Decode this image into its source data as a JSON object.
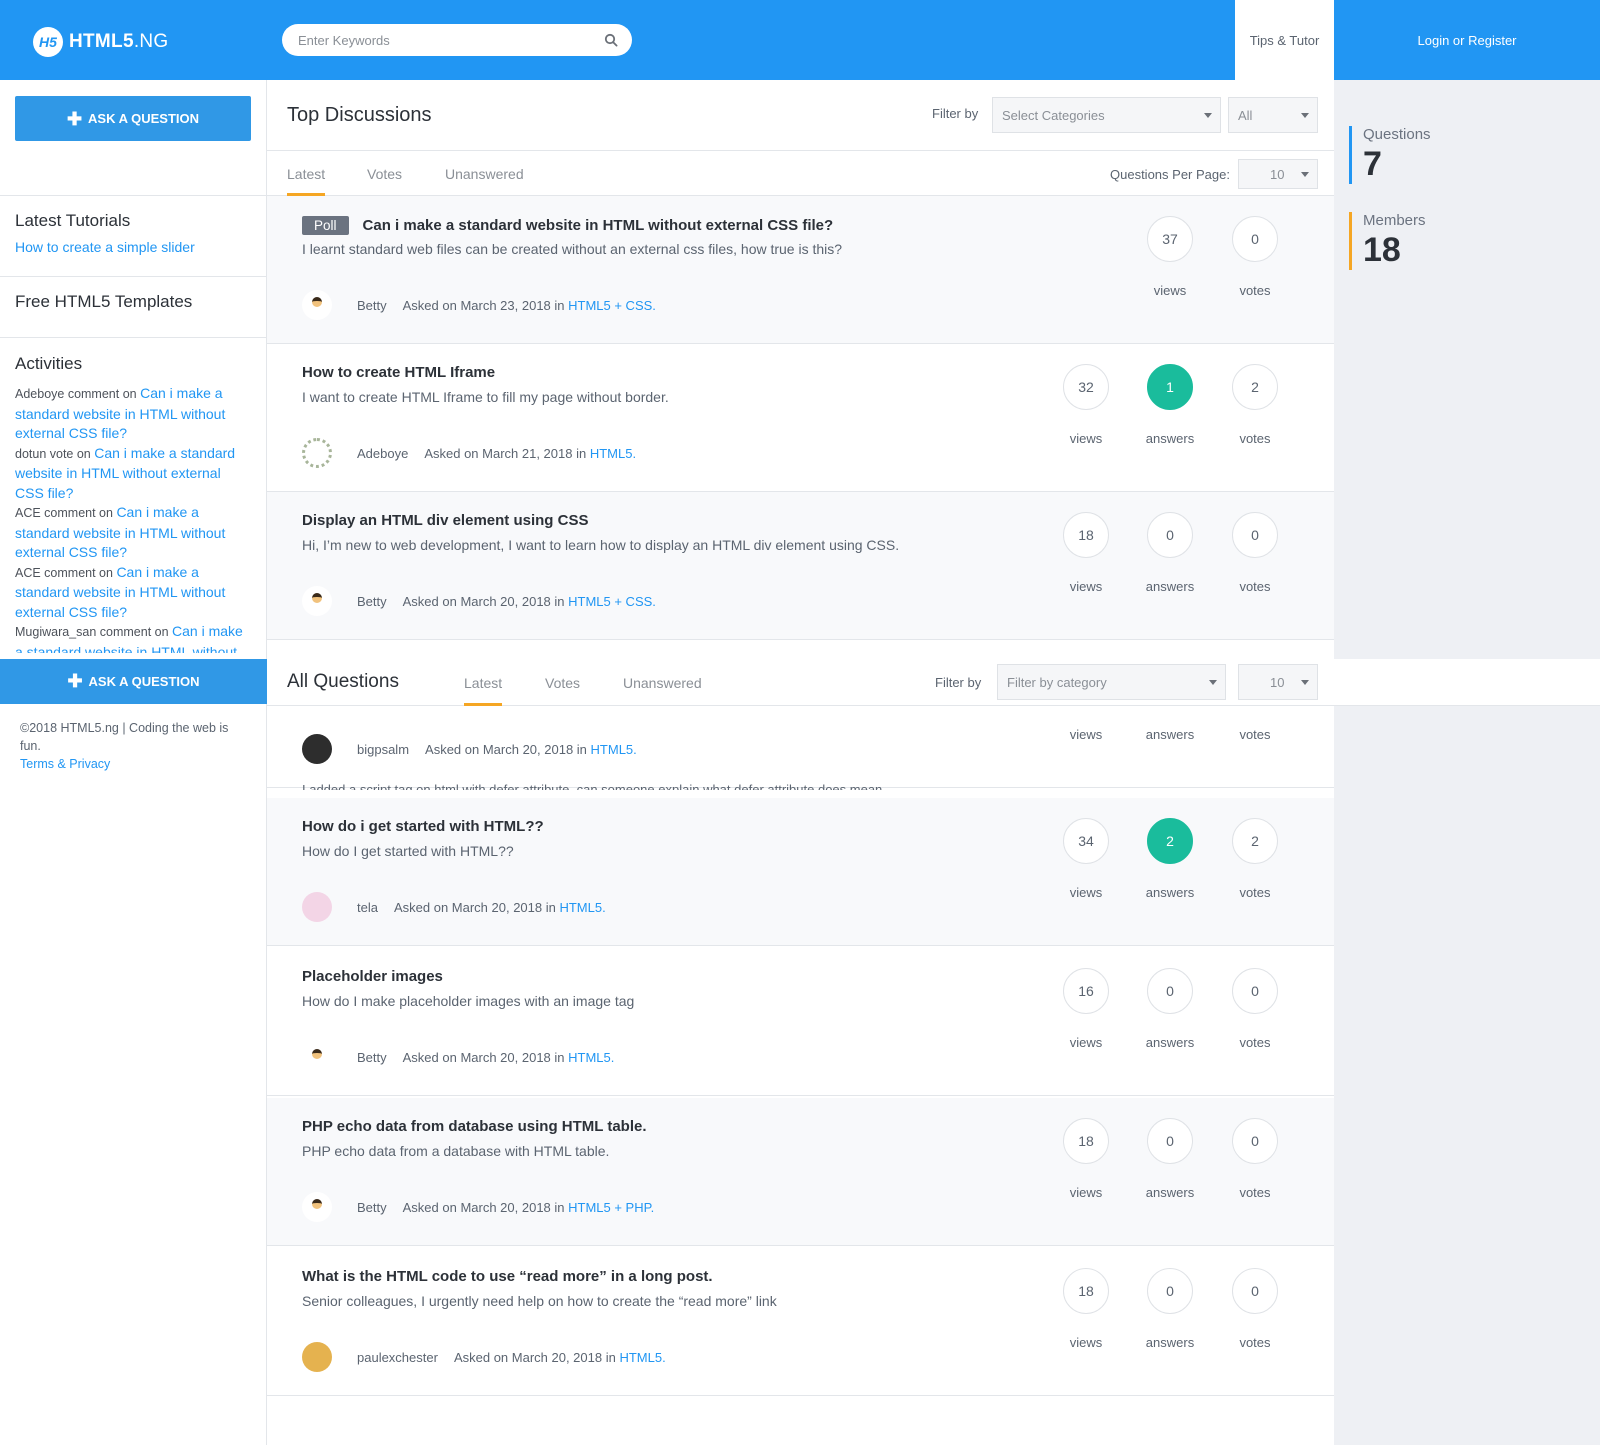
{
  "header": {
    "logo_badge": "H5",
    "logo_bold": "HTML5",
    "logo_light": ".NG",
    "search_placeholder": "Enter Keywords",
    "nav_tips": "Tips & Tutor",
    "nav_login": "Login or Register",
    "brand_color": "#2196f3"
  },
  "sidebar": {
    "ask_label": "ASK A QUESTION",
    "latest_tutorials_title": "Latest Tutorials",
    "latest_tutorial_link": "How to create a simple slider",
    "free_templates_title": "Free HTML5 Templates",
    "activities_title": "Activities",
    "activities": [
      {
        "who": "Adeboye comment on ",
        "link": "Can i make a standard website in HTML without external CSS file?"
      },
      {
        "who": "dotun vote on ",
        "link": "Can i make a standard website in HTML without external CSS file?"
      },
      {
        "who": "ACE comment on ",
        "link": "Can i make a standard website in HTML without external CSS file?"
      },
      {
        "who": "ACE comment on ",
        "link": "Can i make a standard website in HTML without external CSS file?"
      },
      {
        "who": "Mugiwara_san comment on ",
        "link": "Can i make a standard website in HTML without"
      }
    ],
    "ask_bar_label": "ASK A QUESTION",
    "footer_text": "©2018 HTML5.ng | Coding the web is fun.",
    "footer_link": "Terms & Privacy"
  },
  "top_discussions": {
    "title": "Top Discussions",
    "filter_label": "Filter by",
    "category_placeholder": "Select Categories",
    "scope_value": "All",
    "tabs": [
      "Latest",
      "Votes",
      "Unanswered"
    ],
    "per_page_label": "Questions Per Page:",
    "per_page_value": "10"
  },
  "all_questions": {
    "title": "All Questions",
    "tabs": [
      "Latest",
      "Votes",
      "Unanswered"
    ],
    "filter_label": "Filter by",
    "category_placeholder": "Filter by category",
    "per_page_value": "10",
    "hidden_desc": "I added a script tag on html with defer attribute, can someone explain what defer attribute does mean."
  },
  "questions": [
    {
      "poll": "Poll",
      "title": "Can i make a standard website in HTML without external CSS file?",
      "desc": "I learnt standard web files can be created without an external css files, how true is this?",
      "user": "Betty",
      "asked": "Asked on March 23, 2018 in ",
      "category": "HTML5 + CSS.",
      "views": "37",
      "votes": "0",
      "labels": {
        "views": "views",
        "votes": "votes"
      }
    },
    {
      "title": "How to create HTML Iframe",
      "desc": "I want to create HTML Iframe to fill my page without border.",
      "user": "Adeboye",
      "asked": "Asked on March 21, 2018 in ",
      "category": "HTML5.",
      "views": "32",
      "answers": "1",
      "votes": "2",
      "labels": {
        "views": "views",
        "answers": "answers",
        "votes": "votes"
      }
    },
    {
      "title": "Display an HTML div element using CSS",
      "desc": "Hi, I’m new to web development, I want to learn how to display an HTML div element using CSS.",
      "user": "Betty",
      "asked": "Asked on March 20, 2018 in ",
      "category": "HTML5 + CSS.",
      "views": "18",
      "answers": "0",
      "votes": "0",
      "labels": {
        "views": "views",
        "answers": "answers",
        "votes": "votes"
      }
    },
    {
      "title": "",
      "desc": "",
      "user": "bigpsalm",
      "asked": "Asked on March 20, 2018 in ",
      "category": "HTML5.",
      "labels": {
        "views": "views",
        "answers": "answers",
        "votes": "votes"
      }
    },
    {
      "title": "How do i get started with HTML??",
      "desc": "How do I get started with HTML??",
      "user": "tela",
      "asked": "Asked on March 20, 2018 in ",
      "category": "HTML5.",
      "views": "34",
      "answers": "2",
      "votes": "2",
      "labels": {
        "views": "views",
        "answers": "answers",
        "votes": "votes"
      }
    },
    {
      "title": "Placeholder images",
      "desc": "How do I make placeholder images with an image tag",
      "user": "Betty",
      "asked": "Asked on March 20, 2018 in ",
      "category": "HTML5.",
      "views": "16",
      "answers": "0",
      "votes": "0",
      "labels": {
        "views": "views",
        "answers": "answers",
        "votes": "votes"
      }
    },
    {
      "title": "PHP echo data from database using HTML table.",
      "desc": "PHP echo data from a database with HTML table.",
      "user": "Betty",
      "asked": "Asked on March 20, 2018 in ",
      "category": "HTML5 + PHP.",
      "views": "18",
      "answers": "0",
      "votes": "0",
      "labels": {
        "views": "views",
        "answers": "answers",
        "votes": "votes"
      }
    },
    {
      "title": "What is the HTML code to use “read more” in a long post.",
      "desc": "Senior colleagues, I urgently need help on how to create the “read more” link",
      "user": "paulexchester",
      "asked": "Asked on March 20, 2018 in ",
      "category": "HTML5.",
      "views": "18",
      "answers": "0",
      "votes": "0",
      "labels": {
        "views": "views",
        "answers": "answers",
        "votes": "votes"
      }
    }
  ],
  "stats": {
    "questions_label": "Questions",
    "questions_value": "7",
    "questions_color": "#2196f3",
    "members_label": "Members",
    "members_value": "18",
    "members_color": "#f5a623"
  }
}
